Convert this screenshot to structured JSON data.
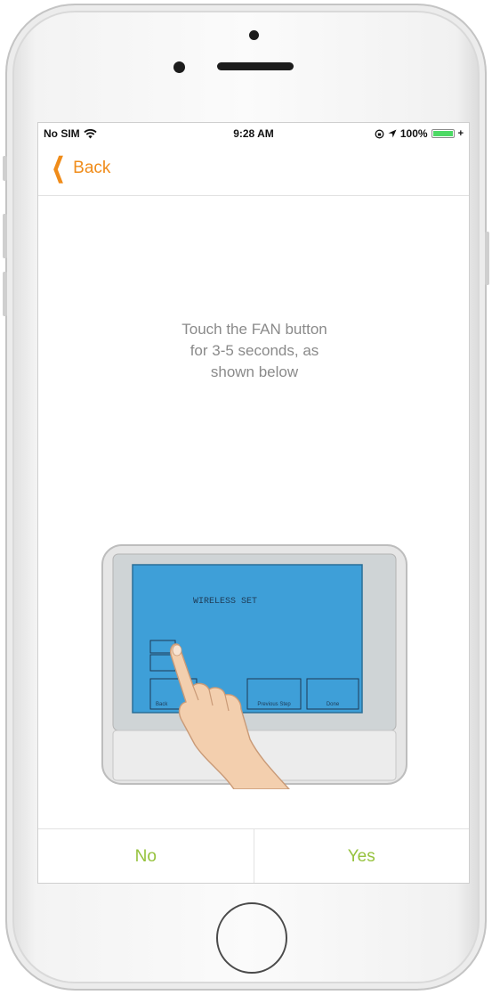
{
  "status_bar": {
    "carrier": "No SIM",
    "time": "9:28 AM",
    "battery_percent": "100%",
    "battery_level": 1.0,
    "battery_color": "#4cd964"
  },
  "nav": {
    "back_label": "Back",
    "accent_color": "#f08c1a"
  },
  "instruction": {
    "line1": "Touch the FAN button",
    "line2": "for 3-5 seconds, as",
    "line3": "shown below"
  },
  "device_screen": {
    "title": "WIRELESS SET",
    "buttons": [
      "Back",
      "Previous Step",
      "Done"
    ],
    "screen_color": "#3e9fd8"
  },
  "actions": {
    "no_label": "No",
    "yes_label": "Yes",
    "color": "#95c23c"
  },
  "icons": [
    "wifi-icon",
    "location-icon",
    "lock-rotation-icon",
    "battery-icon",
    "charging-icon",
    "chevron-left-icon",
    "hand-pointer-icon"
  ]
}
